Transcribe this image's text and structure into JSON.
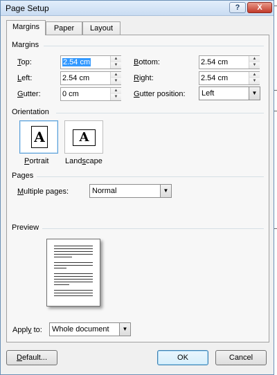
{
  "window": {
    "title": "Page Setup",
    "help_label": "?",
    "close_label": "X"
  },
  "tabs": [
    {
      "label": "Margins",
      "active": true
    },
    {
      "label": "Paper",
      "active": false
    },
    {
      "label": "Layout",
      "active": false
    }
  ],
  "margins": {
    "group_label": "Margins",
    "top": {
      "label": "Top:",
      "value": "2.54 cm"
    },
    "left": {
      "label": "Left:",
      "value": "2.54 cm"
    },
    "gutter": {
      "label": "Gutter:",
      "value": "0 cm"
    },
    "bottom": {
      "label": "Bottom:",
      "value": "2.54 cm"
    },
    "right": {
      "label": "Right:",
      "value": "2.54 cm"
    },
    "gutter_position": {
      "label": "Gutter position:",
      "value": "Left"
    }
  },
  "orientation": {
    "group_label": "Orientation",
    "portrait": {
      "label": "Portrait",
      "glyph": "A",
      "selected": true
    },
    "landscape": {
      "label": "Landscape",
      "glyph": "A",
      "selected": false
    }
  },
  "pages": {
    "group_label": "Pages",
    "multiple_pages": {
      "label": "Multiple pages:",
      "value": "Normal"
    }
  },
  "preview": {
    "group_label": "Preview"
  },
  "apply_to": {
    "label": "Apply to:",
    "value": "Whole document"
  },
  "buttons": {
    "default": "Default...",
    "ok": "OK",
    "cancel": "Cancel"
  },
  "icons": {
    "dropdown": "chevron-down-icon",
    "spin_up": "spin-up-icon",
    "spin_down": "spin-down-icon"
  },
  "colors": {
    "accent": "#3399ff",
    "close": "#c23a2a"
  }
}
